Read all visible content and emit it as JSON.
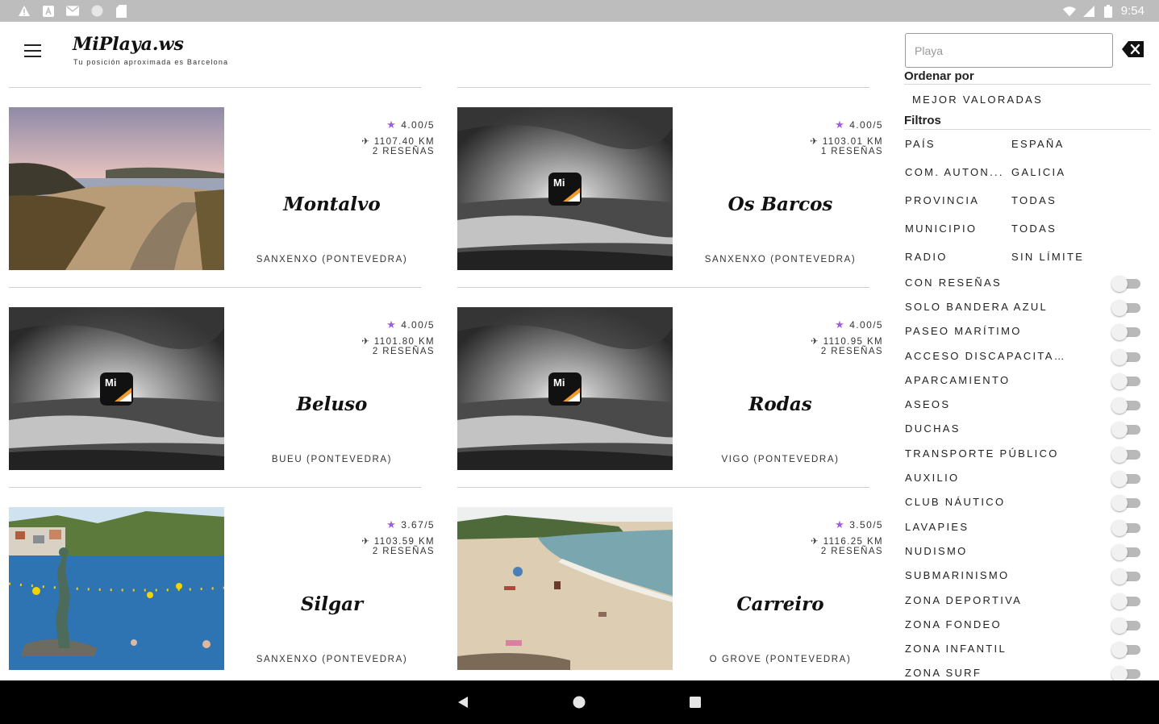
{
  "status_bar": {
    "time": "9:54"
  },
  "app": {
    "title": "MiPlaya.ws",
    "subtitle": "Tu posición aproximada es Barcelona"
  },
  "beaches": [
    {
      "name": "Montalvo",
      "rating": "4.00/5",
      "distance": "1107.40 KM",
      "reviews": "2 RESEÑAS",
      "location": "SANXENXO (PONTEVEDRA)",
      "image": "sunset-coast-photo"
    },
    {
      "name": "Os Barcos",
      "rating": "4.00/5",
      "distance": "1103.01 KM",
      "reviews": "1 RESEÑAS",
      "location": "SANXENXO (PONTEVEDRA)",
      "image": "placeholder-bw-photo"
    },
    {
      "name": "Beluso",
      "rating": "4.00/5",
      "distance": "1101.80 KM",
      "reviews": "2 RESEÑAS",
      "location": "BUEU (PONTEVEDRA)",
      "image": "placeholder-bw-photo"
    },
    {
      "name": "Rodas",
      "rating": "4.00/5",
      "distance": "1110.95 KM",
      "reviews": "2 RESEÑAS",
      "location": "VIGO (PONTEVEDRA)",
      "image": "placeholder-bw-photo"
    },
    {
      "name": "Silgar",
      "rating": "3.67/5",
      "distance": "1103.59 KM",
      "reviews": "2 RESEÑAS",
      "location": "SANXENXO (PONTEVEDRA)",
      "image": "statue-sea-photo"
    },
    {
      "name": "Carreiro",
      "rating": "3.50/5",
      "distance": "1116.25 KM",
      "reviews": "2 RESEÑAS",
      "location": "O GROVE (PONTEVEDRA)",
      "image": "sandy-beach-photo"
    }
  ],
  "filters_panel": {
    "search_placeholder": "Playa",
    "order_heading": "Ordenar por",
    "order_value": "MEJOR VALORADAS",
    "filters_heading": "Filtros",
    "select_filters": [
      {
        "label": "PAÍS",
        "value": "ESPAÑA"
      },
      {
        "label": "COM. AUTON...",
        "value": "GALICIA"
      },
      {
        "label": "PROVINCIA",
        "value": "TODAS"
      },
      {
        "label": "MUNICIPIO",
        "value": "TODAS"
      },
      {
        "label": "RADIO",
        "value": "SIN LÍMITE"
      }
    ],
    "toggles": [
      "CON RESEÑAS",
      "SOLO BANDERA AZUL",
      "PASEO MARÍTIMO",
      "ACCESO DISCAPACITA...",
      "APARCAMIENTO",
      "ASEOS",
      "DUCHAS",
      "TRANSPORTE PÚBLICO",
      "AUXILIO",
      "CLUB NÁUTICO",
      "LAVAPIES",
      "NUDISMO",
      "SUBMARINISMO",
      "ZONA DEPORTIVA",
      "ZONA FONDEO",
      "ZONA INFANTIL",
      "ZONA SURF"
    ]
  },
  "colors": {
    "star": "#9c5de0",
    "status_bar": "#bdbdbd",
    "nav_bar": "#000000",
    "toggle_track": "#b9b9b9"
  }
}
